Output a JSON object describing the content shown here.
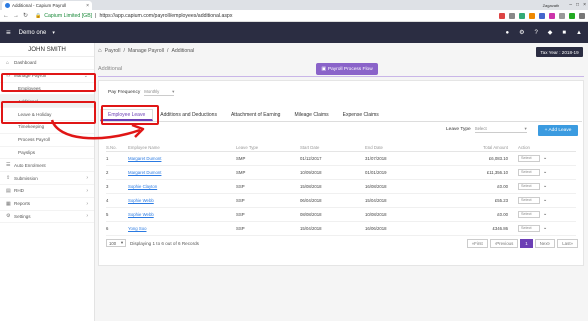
{
  "browser": {
    "tab_title": "Additional - Capium Payroll",
    "user": "Zagavath",
    "url_secure": "Secure",
    "url": "https://app.capium.com/payroll/employees/additional.aspx",
    "company_url_label": "Capium Limited [GB]"
  },
  "topbar": {
    "company": "Demo one"
  },
  "sidebar": {
    "user_name": "JOHN SMITH",
    "items": [
      {
        "label": "Dashboard"
      },
      {
        "label": "Manage Payroll"
      },
      {
        "label": "Employees"
      },
      {
        "label": "Additional"
      },
      {
        "label": "Leave & Holiday"
      },
      {
        "label": "Timekeeping"
      },
      {
        "label": "Process Payroll"
      },
      {
        "label": "Payslips"
      },
      {
        "label": "Auto Enrolment"
      },
      {
        "label": "Submission"
      },
      {
        "label": "RHD"
      },
      {
        "label": "Reports"
      },
      {
        "label": "Settings"
      }
    ]
  },
  "breadcrumb": {
    "home": "Payroll",
    "c1": "Manage Payroll",
    "c2": "Additional"
  },
  "tax_year": "Tax Year : 2018-19",
  "page_title": "Additional",
  "payroll_flow": "Payroll Process Flow",
  "pay_frequency": {
    "label": "Pay Frequency",
    "value": "Monthly"
  },
  "tabs": [
    "Employee Leave",
    "Additions and Deductions",
    "Attachment of Earning",
    "Mileage Claims",
    "Expense Claims"
  ],
  "leave_type": {
    "label": "Leave Type",
    "placeholder": "Select"
  },
  "add_leave": "+ Add Leave",
  "table": {
    "headers": [
      "S.No.",
      "Employee Name",
      "Leave Type",
      "Start Date",
      "End Date",
      "Total Amount",
      "Action"
    ],
    "rows": [
      [
        "1",
        "Margaret Dumont",
        "SMP",
        "01/12/2017",
        "31/07/2018",
        "£6,083.10"
      ],
      [
        "2",
        "Margaret Dumont",
        "SMP",
        "10/09/2018",
        "01/01/2019",
        "£11,356.10"
      ],
      [
        "3",
        "Sophie Clayton",
        "SSP",
        "15/08/2018",
        "16/08/2018",
        "£0.00"
      ],
      [
        "4",
        "Sophie Webb",
        "SSP",
        "06/04/2018",
        "15/04/2018",
        "£55.23"
      ],
      [
        "5",
        "Sophie Webb",
        "SSP",
        "08/08/2018",
        "10/08/2018",
        "£0.00"
      ],
      [
        "6",
        "Yong Soo",
        "SSP",
        "15/04/2018",
        "16/06/2018",
        "£346.86"
      ]
    ],
    "action_select": "Select"
  },
  "pager": {
    "page_size": "100",
    "info": "Displaying 1 to 6 out of 6 Records",
    "first": "First",
    "prev": "Previous",
    "page": "1",
    "next": "Next",
    "last": "Last"
  },
  "colors": {
    "topbar": "#2b2d42",
    "accent": "#6c3fb5",
    "link": "#2a7ae2",
    "highlight": "#e01616"
  }
}
